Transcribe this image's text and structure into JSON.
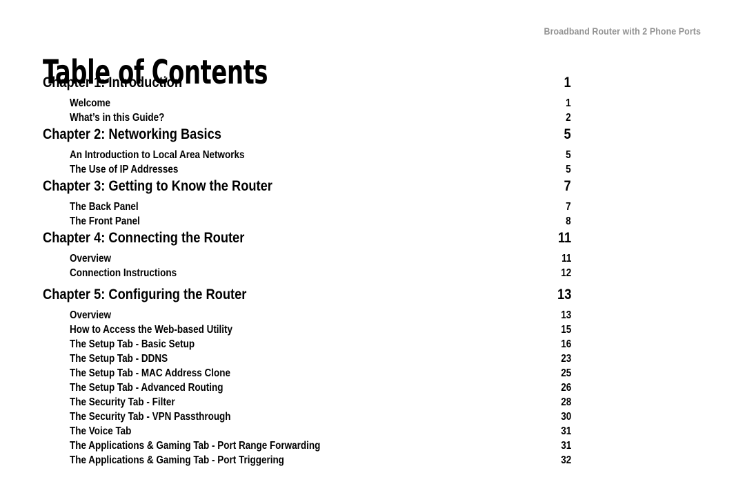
{
  "header": {
    "running_title": "Broadband Router with 2 Phone Ports"
  },
  "title": "Table of Contents",
  "toc": {
    "entries": [
      {
        "level": "chapter",
        "label": "Chapter 1: Introduction",
        "page": "1"
      },
      {
        "level": "section",
        "label": "Welcome",
        "page": "1"
      },
      {
        "level": "section",
        "label": "What’s in this Guide?",
        "page": "2"
      },
      {
        "level": "chapter",
        "label": "Chapter 2: Networking Basics",
        "page": "5"
      },
      {
        "level": "section",
        "label": "An Introduction to Local Area Networks",
        "page": "5"
      },
      {
        "level": "section",
        "label": "The Use of IP Addresses",
        "page": "5"
      },
      {
        "level": "chapter",
        "label": "Chapter 3: Getting to Know the Router",
        "page": "7"
      },
      {
        "level": "section",
        "label": "The Back Panel",
        "page": "7"
      },
      {
        "level": "section",
        "label": "The Front Panel",
        "page": "8"
      },
      {
        "level": "chapter",
        "label": "Chapter 4: Connecting the Router",
        "page": "11"
      },
      {
        "level": "section",
        "label": "Overview",
        "page": "11"
      },
      {
        "level": "section",
        "label": "Connection Instructions",
        "page": "12"
      },
      {
        "level": "chapter",
        "label": "Chapter 5: Configuring the Router",
        "page": "13",
        "extra_gap": true
      },
      {
        "level": "section",
        "label": "Overview",
        "page": "13"
      },
      {
        "level": "section",
        "label": "How to Access the Web-based Utility",
        "page": "15"
      },
      {
        "level": "section",
        "label": "The Setup Tab - Basic Setup",
        "page": "16"
      },
      {
        "level": "section",
        "label": "The Setup Tab - DDNS",
        "page": "23"
      },
      {
        "level": "section",
        "label": "The Setup Tab - MAC Address Clone",
        "page": "25"
      },
      {
        "level": "section",
        "label": "The Setup Tab - Advanced Routing",
        "page": "26"
      },
      {
        "level": "section",
        "label": "The Security Tab - Filter",
        "page": "28"
      },
      {
        "level": "section",
        "label": "The Security Tab - VPN Passthrough",
        "page": "30"
      },
      {
        "level": "section",
        "label": "The Voice Tab",
        "page": "31"
      },
      {
        "level": "section",
        "label": "The Applications & Gaming Tab - Port Range Forwarding",
        "page": "31"
      },
      {
        "level": "section",
        "label": "The Applications & Gaming Tab - Port Triggering",
        "page": "32"
      }
    ]
  }
}
